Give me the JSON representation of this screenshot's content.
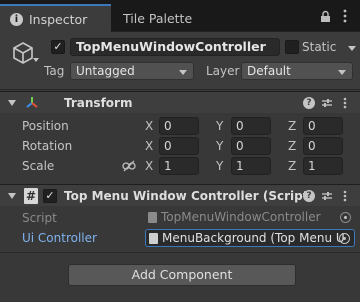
{
  "tabs": [
    {
      "label": "Inspector",
      "active": true
    },
    {
      "label": "Tile Palette",
      "active": false
    }
  ],
  "gameobject": {
    "active": true,
    "name": "TopMenuWindowController",
    "static_label": "Static",
    "static_checked": false,
    "tag_label": "Tag",
    "tag_value": "Untagged",
    "layer_label": "Layer",
    "layer_value": "Default"
  },
  "transform": {
    "title": "Transform",
    "rows": [
      {
        "label": "Position",
        "x": "0",
        "y": "0",
        "z": "0"
      },
      {
        "label": "Rotation",
        "x": "0",
        "y": "0",
        "z": "0"
      },
      {
        "label": "Scale",
        "x": "1",
        "y": "1",
        "z": "1"
      }
    ],
    "axes": [
      "X",
      "Y",
      "Z"
    ]
  },
  "script_component": {
    "enabled": true,
    "title": "Top Menu Window Controller (Script)",
    "script_label": "Script",
    "script_value": "TopMenuWindowController",
    "field_label": "Ui Controller",
    "field_value": "MenuBackground (Top Menu U"
  },
  "add_component_label": "Add Component",
  "colors": {
    "accent": "#3a79bb",
    "field_label_blue": "#7fb2ee",
    "background": "#383838"
  }
}
